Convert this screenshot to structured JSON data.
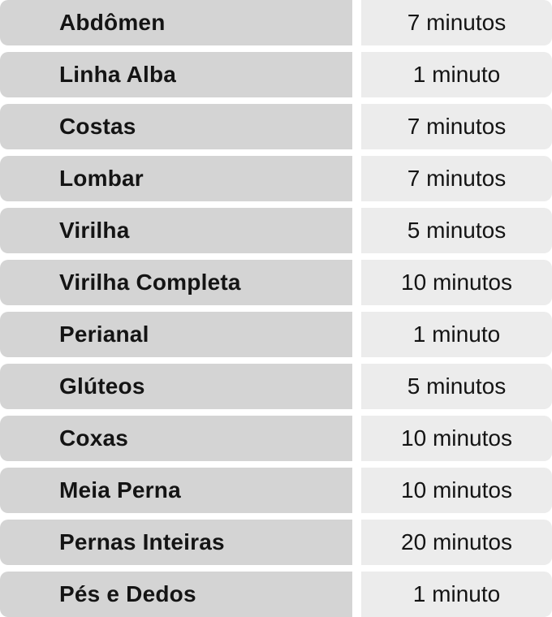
{
  "rows": [
    {
      "area": "Abdômen",
      "duration": "7 minutos"
    },
    {
      "area": "Linha Alba",
      "duration": "1 minuto"
    },
    {
      "area": "Costas",
      "duration": "7 minutos"
    },
    {
      "area": "Lombar",
      "duration": "7 minutos"
    },
    {
      "area": "Virilha",
      "duration": "5 minutos"
    },
    {
      "area": "Virilha Completa",
      "duration": "10 minutos"
    },
    {
      "area": "Perianal",
      "duration": "1 minuto"
    },
    {
      "area": "Glúteos",
      "duration": "5 minutos"
    },
    {
      "area": "Coxas",
      "duration": "10 minutos"
    },
    {
      "area": "Meia Perna",
      "duration": "10 minutos"
    },
    {
      "area": "Pernas Inteiras",
      "duration": "20 minutos"
    },
    {
      "area": "Pés e Dedos",
      "duration": "1 minuto"
    }
  ],
  "colors": {
    "name_cell_bg": "#d4d4d4",
    "time_cell_bg": "#ececec",
    "text": "#141414"
  }
}
